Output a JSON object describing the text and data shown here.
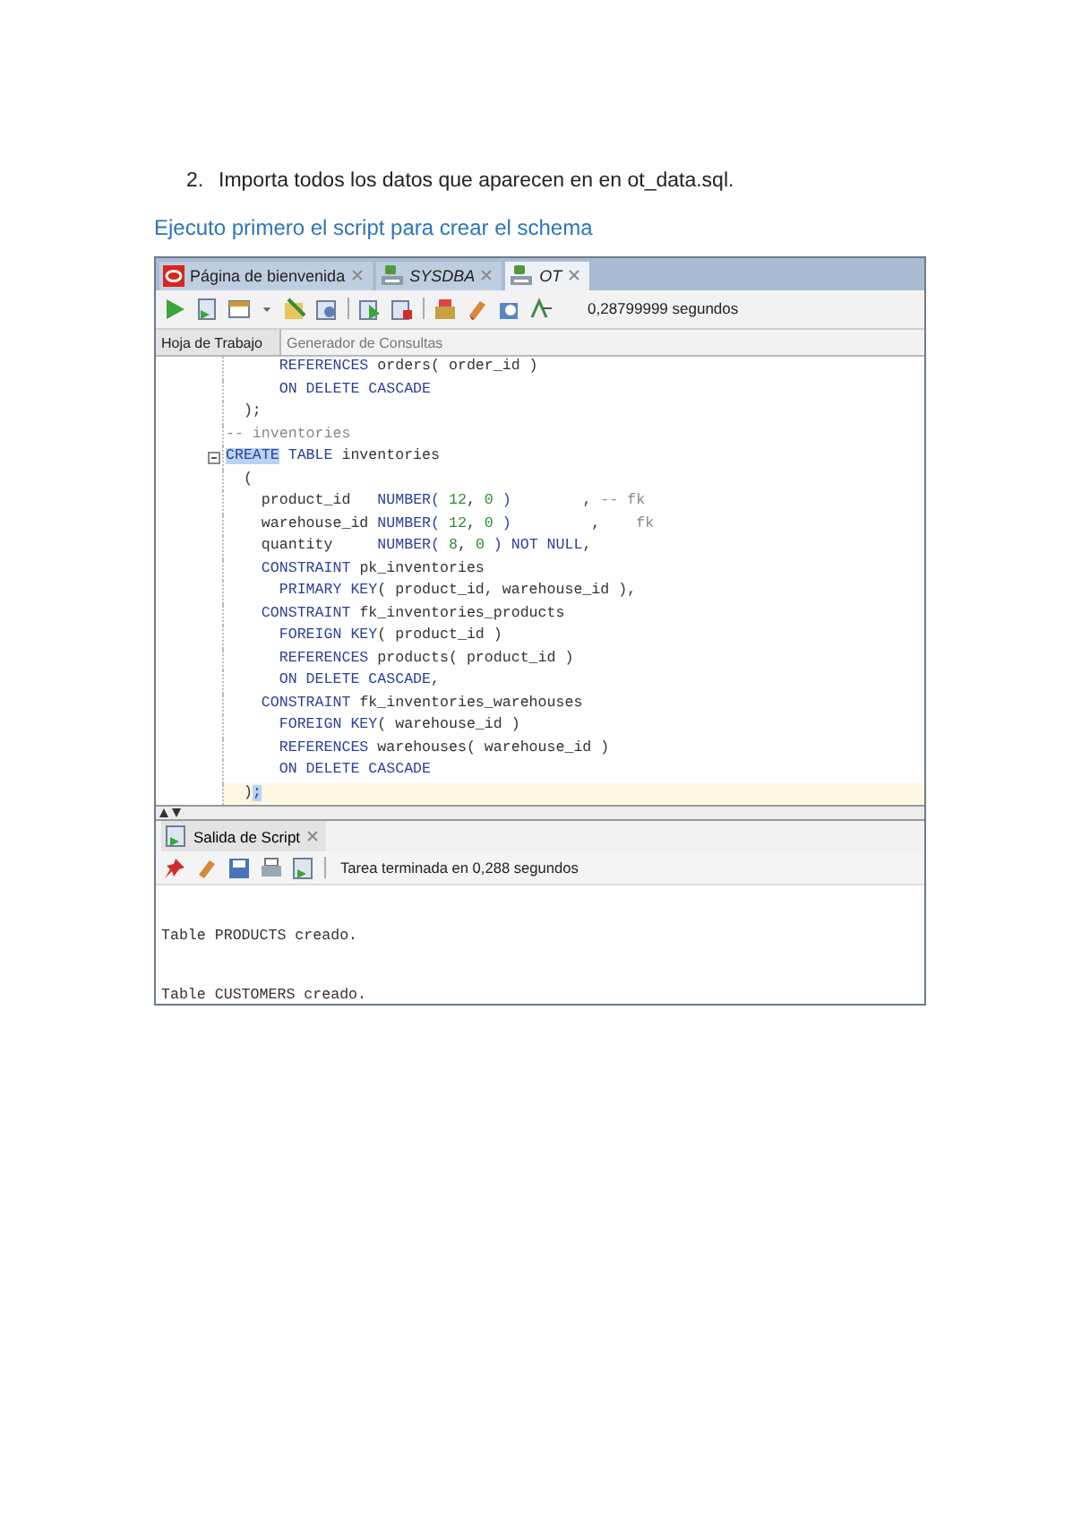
{
  "document": {
    "list_item": {
      "number": "2.",
      "text": "Importa todos los datos que aparecen en en ot_data.sql."
    },
    "heading": "Ejecuto primero el script para crear el schema"
  },
  "window": {
    "tabs": [
      {
        "label": "Página de bienvenida",
        "kind": "home",
        "selected": false
      },
      {
        "label": "SYSDBA",
        "kind": "connection",
        "selected": false
      },
      {
        "label": "OT",
        "kind": "connection",
        "selected": true
      }
    ],
    "toolbar": {
      "timing": "0,28799999 segundos"
    },
    "editor_tabs": [
      {
        "label": "Hoja de Trabajo",
        "selected": true
      },
      {
        "label": "Generador de Consultas",
        "selected": false
      }
    ],
    "code_lines": [
      {
        "fold": false,
        "current": false,
        "tokens": [
          {
            "kind": "kw",
            "text": "      REFERENCES"
          },
          {
            "kind": "plain",
            "text": " orders( order_id )"
          }
        ]
      },
      {
        "fold": false,
        "current": false,
        "tokens": [
          {
            "kind": "kw",
            "text": "      ON DELETE CASCADE"
          }
        ]
      },
      {
        "fold": false,
        "current": false,
        "tokens": [
          {
            "kind": "plain",
            "text": "  );"
          }
        ]
      },
      {
        "fold": false,
        "current": false,
        "tokens": [
          {
            "kind": "comment",
            "text": "-- inventories"
          }
        ]
      },
      {
        "fold": true,
        "current": false,
        "tokens": [
          {
            "kind": "match",
            "text": "CREATE"
          },
          {
            "kind": "kw",
            "text": " TABLE"
          },
          {
            "kind": "plain",
            "text": " inventories"
          }
        ]
      },
      {
        "fold": false,
        "current": false,
        "tokens": [
          {
            "kind": "plain",
            "text": "  ("
          }
        ]
      },
      {
        "fold": false,
        "current": false,
        "tokens": [
          {
            "kind": "plain",
            "text": "    product_id   "
          },
          {
            "kind": "kw",
            "text": "NUMBER("
          },
          {
            "kind": "num",
            "text": " 12"
          },
          {
            "kind": "plain",
            "text": ","
          },
          {
            "kind": "num",
            "text": " 0"
          },
          {
            "kind": "kw",
            "text": " )"
          },
          {
            "kind": "plain",
            "text": "        , "
          },
          {
            "kind": "comment",
            "text": "-- fk"
          }
        ]
      },
      {
        "fold": false,
        "current": false,
        "tokens": [
          {
            "kind": "plain",
            "text": "    warehouse_id "
          },
          {
            "kind": "kw",
            "text": "NUMBER("
          },
          {
            "kind": "num",
            "text": " 12"
          },
          {
            "kind": "plain",
            "text": ","
          },
          {
            "kind": "num",
            "text": " 0"
          },
          {
            "kind": "kw",
            "text": " )"
          },
          {
            "kind": "plain",
            "text": "         ,    "
          },
          {
            "kind": "comment",
            "text": "fk"
          }
        ]
      },
      {
        "fold": false,
        "current": false,
        "tokens": [
          {
            "kind": "plain",
            "text": "    quantity     "
          },
          {
            "kind": "kw",
            "text": "NUMBER("
          },
          {
            "kind": "num",
            "text": " 8"
          },
          {
            "kind": "plain",
            "text": ","
          },
          {
            "kind": "num",
            "text": " 0"
          },
          {
            "kind": "kw",
            "text": " ) NOT NULL"
          },
          {
            "kind": "plain",
            "text": ","
          }
        ]
      },
      {
        "fold": false,
        "current": false,
        "tokens": [
          {
            "kind": "kw",
            "text": "    CONSTRAINT"
          },
          {
            "kind": "plain",
            "text": " pk_inventories"
          }
        ]
      },
      {
        "fold": false,
        "current": false,
        "tokens": [
          {
            "kind": "kw",
            "text": "      PRIMARY KEY"
          },
          {
            "kind": "plain",
            "text": "( product_id, warehouse_id ),"
          }
        ]
      },
      {
        "fold": false,
        "current": false,
        "tokens": [
          {
            "kind": "kw",
            "text": "    CONSTRAINT"
          },
          {
            "kind": "plain",
            "text": " fk_inventories_products"
          }
        ]
      },
      {
        "fold": false,
        "current": false,
        "tokens": [
          {
            "kind": "kw",
            "text": "      FOREIGN KEY"
          },
          {
            "kind": "plain",
            "text": "( product_id )"
          }
        ]
      },
      {
        "fold": false,
        "current": false,
        "tokens": [
          {
            "kind": "kw",
            "text": "      REFERENCES"
          },
          {
            "kind": "plain",
            "text": " products( product_id )"
          }
        ]
      },
      {
        "fold": false,
        "current": false,
        "tokens": [
          {
            "kind": "kw",
            "text": "      ON DELETE CASCADE"
          },
          {
            "kind": "plain",
            "text": ","
          }
        ]
      },
      {
        "fold": false,
        "current": false,
        "tokens": [
          {
            "kind": "kw",
            "text": "    CONSTRAINT"
          },
          {
            "kind": "plain",
            "text": " fk_inventories_warehouses"
          }
        ]
      },
      {
        "fold": false,
        "current": false,
        "tokens": [
          {
            "kind": "kw",
            "text": "      FOREIGN KEY"
          },
          {
            "kind": "plain",
            "text": "( warehouse_id )"
          }
        ]
      },
      {
        "fold": false,
        "current": false,
        "tokens": [
          {
            "kind": "kw",
            "text": "      REFERENCES"
          },
          {
            "kind": "plain",
            "text": " warehouses( warehouse_id )"
          }
        ]
      },
      {
        "fold": false,
        "current": false,
        "tokens": [
          {
            "kind": "kw",
            "text": "      ON DELETE CASCADE"
          }
        ]
      },
      {
        "fold": false,
        "current": true,
        "tokens": [
          {
            "kind": "plain",
            "text": "  )"
          },
          {
            "kind": "match",
            "text": ";"
          }
        ]
      }
    ],
    "output_panel": {
      "tab": "Salida de Script",
      "status": "Tarea terminada en 0,288 segundos",
      "lines": [
        "Table PRODUCTS creado.",
        "Table CUSTOMERS creado."
      ]
    }
  }
}
